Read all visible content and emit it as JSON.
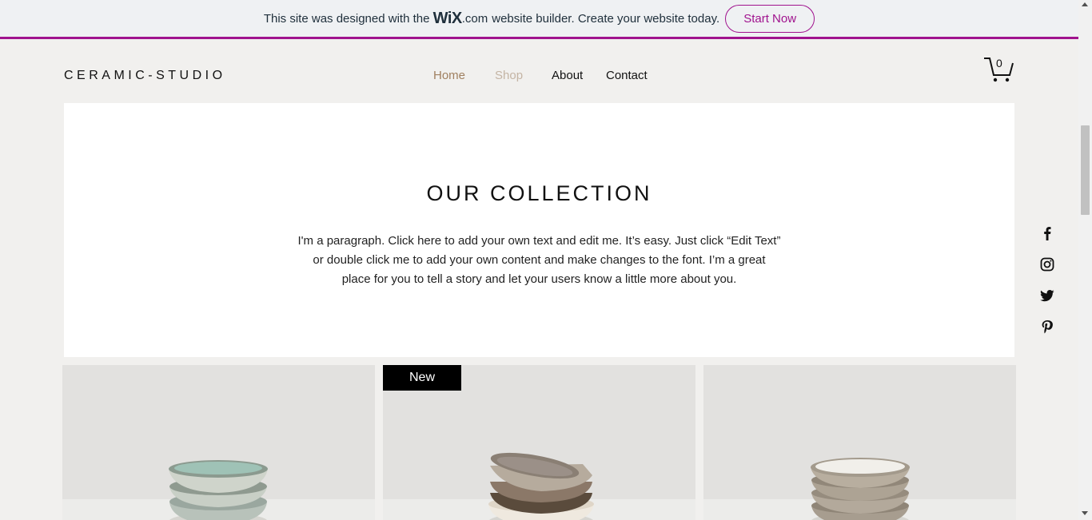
{
  "banner": {
    "text_before": "This site was designed with the",
    "wix_logo": "WiX",
    "dotcom": ".com",
    "text_after": "website builder. Create your website today.",
    "cta_label": "Start Now",
    "accent_color": "#a0138e"
  },
  "header": {
    "logo": "CERAMIC-STUDIO",
    "nav": [
      {
        "label": "Home",
        "color": "#a08060"
      },
      {
        "label": "Shop",
        "color": "#c4b4a4"
      },
      {
        "label": "About",
        "color": "#111111"
      },
      {
        "label": "Contact",
        "color": "#111111"
      }
    ],
    "cart_count": "0"
  },
  "collection": {
    "title": "OUR COLLECTION",
    "paragraph": "I'm a paragraph. Click here to add your own text and edit me. It’s easy. Just click “Edit Text” or double click me to add your own content and make changes to the font. I’m a great place for you to tell a story and let your users know a little more about you."
  },
  "social": [
    "facebook-icon",
    "instagram-icon",
    "twitter-icon",
    "pinterest-icon"
  ],
  "products": [
    {
      "badge": "",
      "image": "stack of green-glazed ceramic bowls"
    },
    {
      "badge": "New",
      "image": "stack of grey and cream ceramic bowls"
    },
    {
      "badge": "",
      "image": "stack of beige speckled ceramic bowls"
    }
  ]
}
